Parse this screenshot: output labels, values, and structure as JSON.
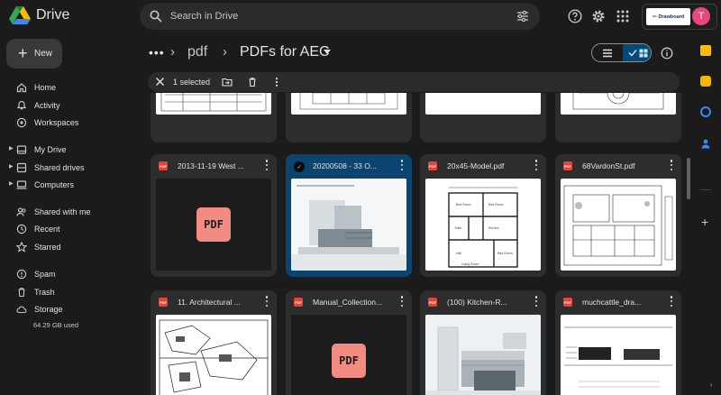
{
  "app": {
    "name": "Drive"
  },
  "search": {
    "placeholder": "Search in Drive"
  },
  "topbar": {
    "drawboard_label": "Drawboard",
    "avatar_initial": "T"
  },
  "sidebar": {
    "new_label": "New",
    "items": [
      {
        "label": "Home",
        "icon": "home-icon"
      },
      {
        "label": "Activity",
        "icon": "activity-icon"
      },
      {
        "label": "Workspaces",
        "icon": "workspaces-icon"
      },
      {
        "label": "My Drive",
        "icon": "my-drive-icon"
      },
      {
        "label": "Shared drives",
        "icon": "shared-drives-icon"
      },
      {
        "label": "Computers",
        "icon": "computers-icon"
      },
      {
        "label": "Shared with me",
        "icon": "shared-with-me-icon"
      },
      {
        "label": "Recent",
        "icon": "recent-icon"
      },
      {
        "label": "Starred",
        "icon": "star-icon"
      },
      {
        "label": "Spam",
        "icon": "spam-icon"
      },
      {
        "label": "Trash",
        "icon": "trash-icon"
      },
      {
        "label": "Storage",
        "icon": "cloud-icon"
      }
    ],
    "storage_used": "64.29 GB used"
  },
  "breadcrumb": {
    "parent": "pdf",
    "current": "PDFs for AEC"
  },
  "selection": {
    "count_label": "1 selected"
  },
  "files": [
    {
      "name": "2013-11-19 West ...",
      "thumb": "pdf-placeholder",
      "selected": false
    },
    {
      "name": "20200508 - 33 O...",
      "thumb": "building-render",
      "selected": true
    },
    {
      "name": "20x45-Model.pdf",
      "thumb": "floor-plan",
      "selected": false
    },
    {
      "name": "68VardonSt.pdf",
      "thumb": "site-plan",
      "selected": false
    },
    {
      "name": "11. Architectural ...",
      "thumb": "arch-plan",
      "selected": false
    },
    {
      "name": "Manual_Collection...",
      "thumb": "pdf-placeholder",
      "selected": false
    },
    {
      "name": "(100) Kitchen-R...",
      "thumb": "kitchen-render",
      "selected": false
    },
    {
      "name": "muchcattle_dra...",
      "thumb": "elevation",
      "selected": false
    }
  ],
  "pdf_badge": "PDF",
  "colors": {
    "accent": "#004a77",
    "selected_card": "#0b446e",
    "pdf_red": "#f28b82",
    "avatar": "#e8467c"
  }
}
